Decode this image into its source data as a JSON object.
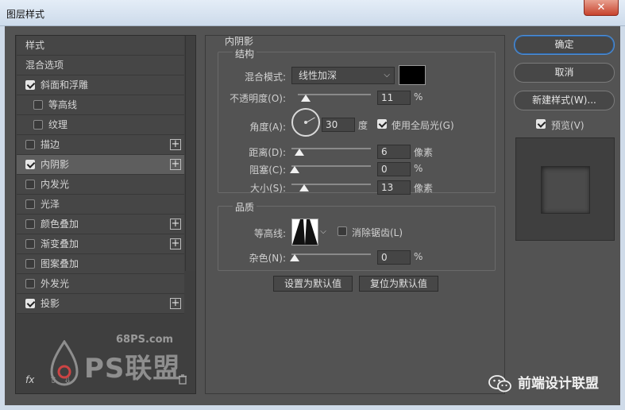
{
  "window": {
    "title": "图层样式",
    "close_glyph": "✕"
  },
  "styles_list": {
    "header": "样式",
    "blend_options": "混合选项",
    "items": [
      {
        "label": "斜面和浮雕",
        "checked": true,
        "plus": false,
        "indent": false
      },
      {
        "label": "等高线",
        "checked": false,
        "plus": false,
        "indent": true
      },
      {
        "label": "纹理",
        "checked": false,
        "plus": false,
        "indent": true
      },
      {
        "label": "描边",
        "checked": false,
        "plus": true,
        "indent": false
      },
      {
        "label": "内阴影",
        "checked": true,
        "plus": true,
        "indent": false,
        "selected": true
      },
      {
        "label": "内发光",
        "checked": false,
        "plus": false,
        "indent": false
      },
      {
        "label": "光泽",
        "checked": false,
        "plus": false,
        "indent": false
      },
      {
        "label": "颜色叠加",
        "checked": false,
        "plus": true,
        "indent": false
      },
      {
        "label": "渐变叠加",
        "checked": false,
        "plus": true,
        "indent": false
      },
      {
        "label": "图案叠加",
        "checked": false,
        "plus": false,
        "indent": false
      },
      {
        "label": "外发光",
        "checked": false,
        "plus": false,
        "indent": false
      },
      {
        "label": "投影",
        "checked": true,
        "plus": true,
        "indent": false
      }
    ],
    "footer": {
      "fx": "fx",
      "trash_icon": "trash-icon"
    }
  },
  "watermark": {
    "site": "68PS.com",
    "brand": "PS联盟"
  },
  "inner_shadow": {
    "title": "内阴影",
    "structure": {
      "title": "结构",
      "blend_mode_label": "混合模式:",
      "blend_mode_value": "线性加深",
      "color": "#000000",
      "opacity_label": "不透明度(O):",
      "opacity_value": "11",
      "opacity_unit": "%",
      "opacity_level": 0.11,
      "angle_label": "角度(A):",
      "angle_value": "30",
      "angle_unit": "度",
      "global_light_label": "使用全局光(G)",
      "global_light_checked": true,
      "distance_label": "距离(D):",
      "distance_value": "6",
      "distance_unit": "像素",
      "choke_label": "阻塞(C):",
      "choke_value": "0",
      "choke_unit": "%",
      "size_label": "大小(S):",
      "size_value": "13",
      "size_unit": "像素"
    },
    "quality": {
      "title": "品质",
      "contour_label": "等高线:",
      "antialias_label": "消除锯齿(L)",
      "antialias_checked": false,
      "noise_label": "杂色(N):",
      "noise_value": "0",
      "noise_unit": "%"
    },
    "buttons": {
      "set_default": "设置为默认值",
      "reset_default": "复位为默认值"
    }
  },
  "actions": {
    "ok": "确定",
    "cancel": "取消",
    "new_style": "新建样式(W)...",
    "preview_label": "预览(V)",
    "preview_checked": true
  },
  "footer_brand": "前端设计联盟"
}
